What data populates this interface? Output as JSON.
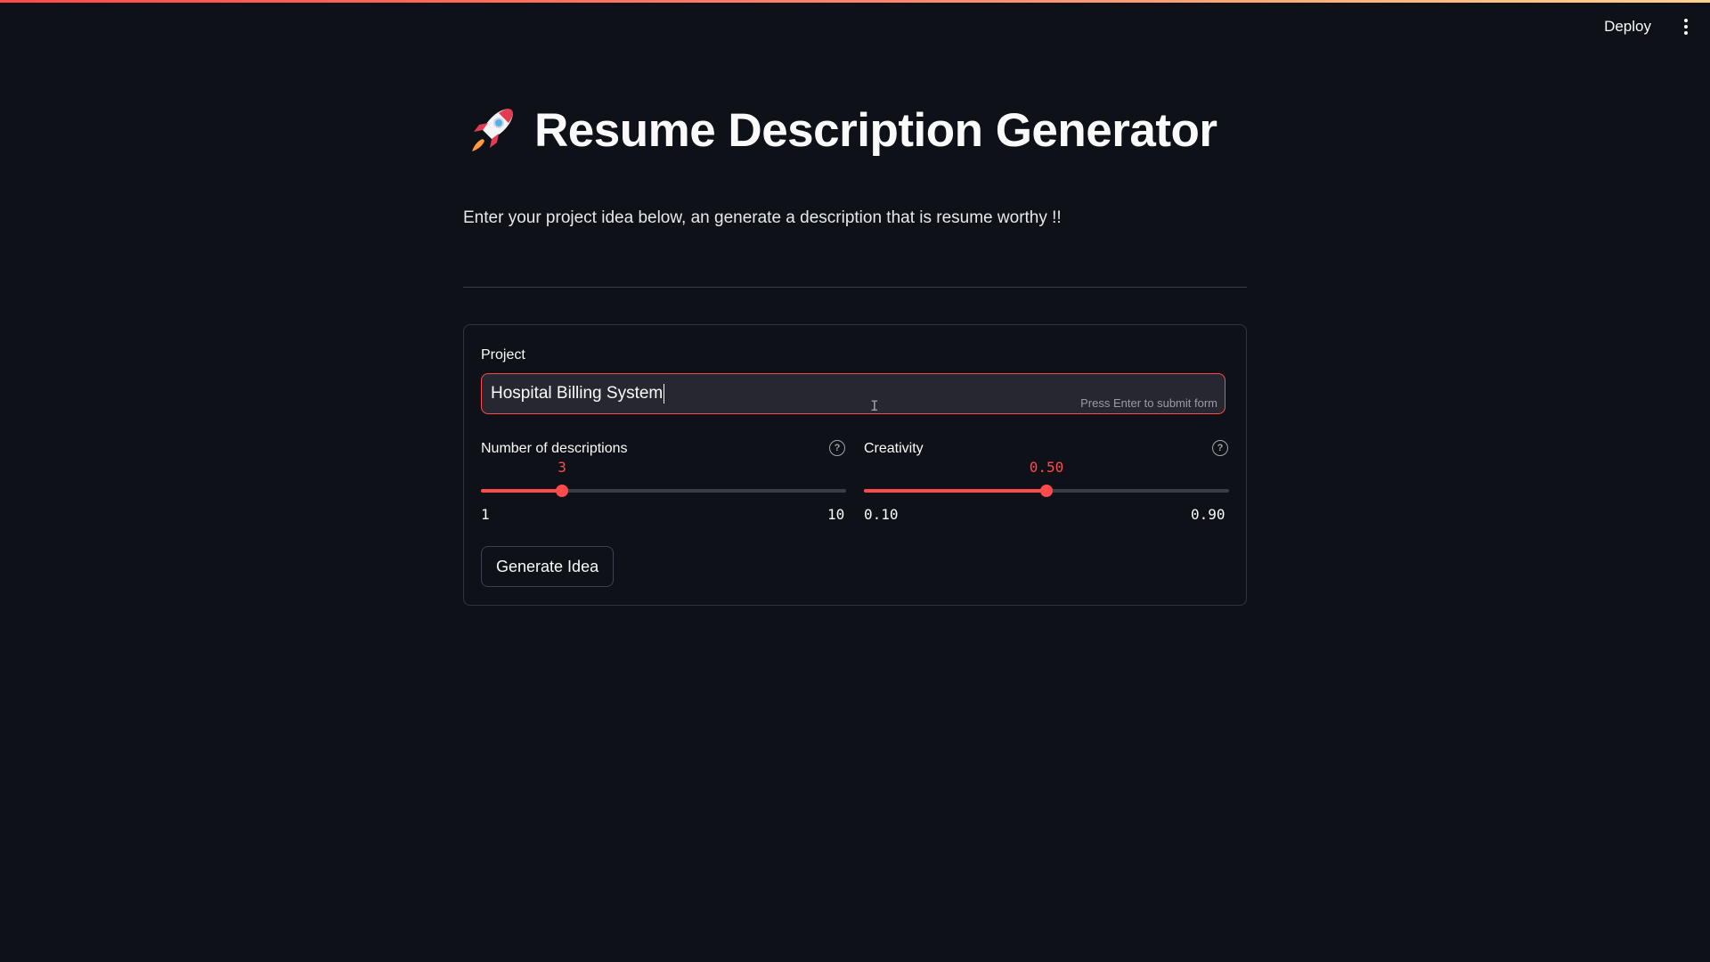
{
  "header": {
    "deploy_label": "Deploy",
    "menu_icon": "vertical-dots-icon"
  },
  "page": {
    "title_icon": "rocket-icon",
    "title": "Resume Description Generator",
    "subtitle": "Enter your project idea below, an generate a description that is resume worthy !!"
  },
  "form": {
    "project": {
      "label": "Project",
      "value": "Hospital Billing System",
      "hint": "Press Enter to submit form"
    },
    "num_descriptions": {
      "label": "Number of descriptions",
      "value": "3",
      "min": "1",
      "max": "10",
      "fraction": 0.222,
      "help_icon": "help-circle-icon"
    },
    "creativity": {
      "label": "Creativity",
      "value": "0.50",
      "min": "0.10",
      "max": "0.90",
      "fraction": 0.5,
      "help_icon": "help-circle-icon"
    },
    "submit_label": "Generate Idea"
  },
  "colors": {
    "accent": "#ff4b4b",
    "background": "#0e1117",
    "input_bg": "#262730"
  }
}
